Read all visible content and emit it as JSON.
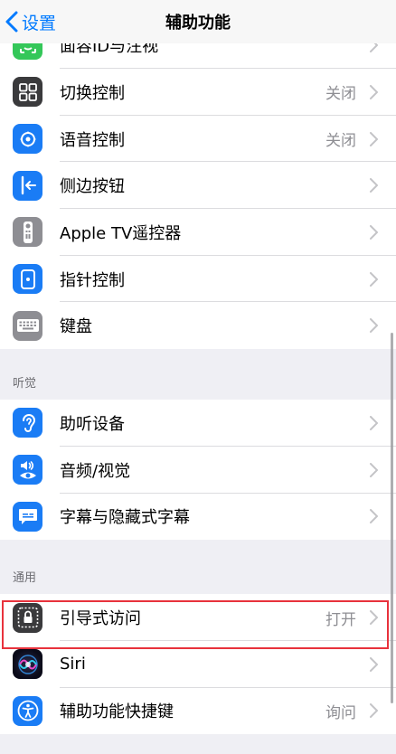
{
  "nav": {
    "back_label": "设置",
    "title": "辅助功能"
  },
  "top_item": {
    "label": "面容ID与注视"
  },
  "group1": [
    {
      "label": "切换控制",
      "value": "关闭",
      "icon": "switch-control-icon",
      "color": "#3a3a3c"
    },
    {
      "label": "语音控制",
      "value": "关闭",
      "icon": "voice-control-icon",
      "color": "#1a7cf5"
    },
    {
      "label": "侧边按钮",
      "value": "",
      "icon": "side-button-icon",
      "color": "#1a7cf5"
    },
    {
      "label": "Apple TV遥控器",
      "value": "",
      "icon": "tv-remote-icon",
      "color": "#8e8e93"
    },
    {
      "label": "指针控制",
      "value": "",
      "icon": "pointer-control-icon",
      "color": "#1a7cf5"
    },
    {
      "label": "键盘",
      "value": "",
      "icon": "keyboard-icon",
      "color": "#8e8e93"
    }
  ],
  "section_hearing": {
    "header": "听觉"
  },
  "group2": [
    {
      "label": "助听设备",
      "value": "",
      "icon": "ear-icon",
      "color": "#1a7cf5"
    },
    {
      "label": "音频/视觉",
      "value": "",
      "icon": "audio-visual-icon",
      "color": "#1a7cf5"
    },
    {
      "label": "字幕与隐藏式字幕",
      "value": "",
      "icon": "subtitles-icon",
      "color": "#1a7cf5"
    }
  ],
  "section_general": {
    "header": "通用"
  },
  "group3": [
    {
      "label": "引导式访问",
      "value": "打开",
      "icon": "guided-access-icon",
      "color": "#3a3a3c"
    },
    {
      "label": "Siri",
      "value": "",
      "icon": "siri-icon",
      "color": "#1c1c3a"
    },
    {
      "label": "辅助功能快捷键",
      "value": "询问",
      "icon": "accessibility-icon",
      "color": "#1a7cf5"
    }
  ]
}
